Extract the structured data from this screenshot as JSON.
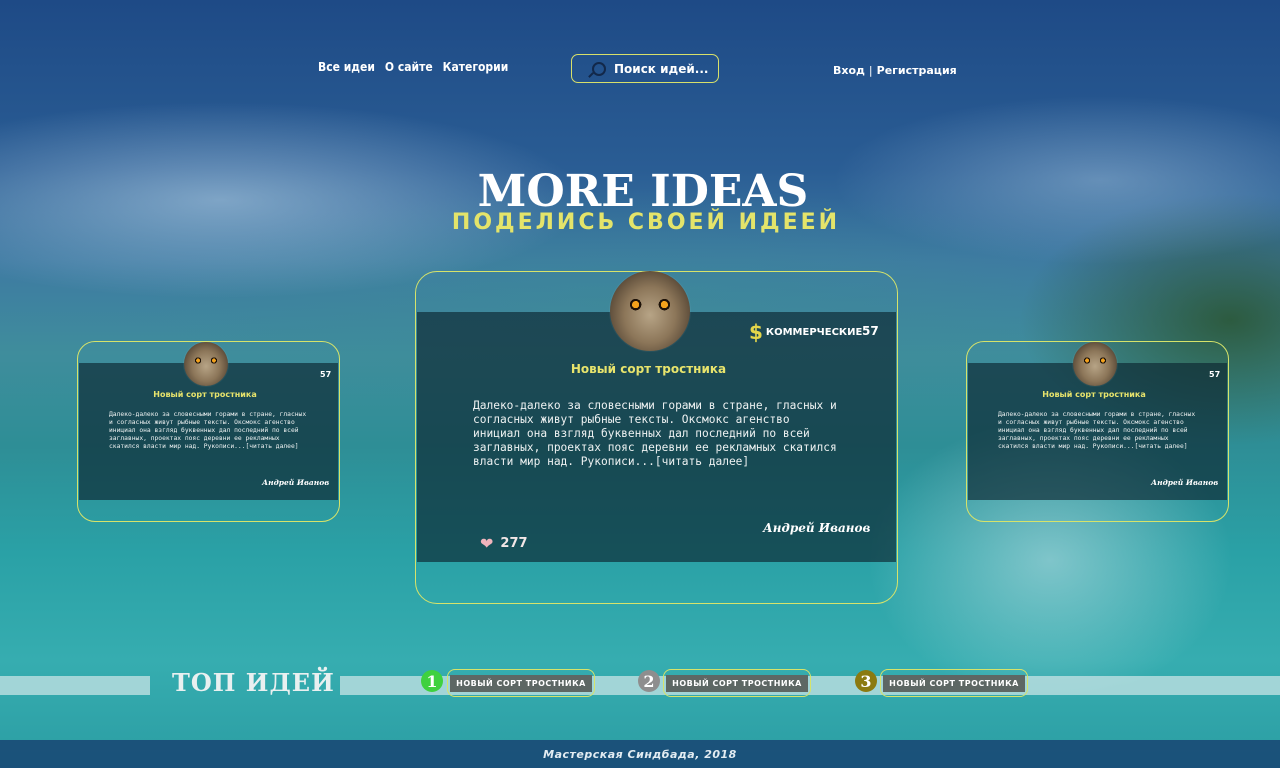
{
  "nav": {
    "items": [
      "Все идеи",
      "О сайте",
      "Категории"
    ]
  },
  "search": {
    "placeholder": "Поиск идей..."
  },
  "auth": {
    "login": "Вход",
    "separator": "|",
    "register": "Регистрация"
  },
  "hero": {
    "title": "MORE IDEAS",
    "subtitle": "ПОДЕЛИСЬ СВОЕЙ ИДЕЕЙ"
  },
  "cards": {
    "left": {
      "title": "Новый сорт тростника",
      "count": "57",
      "text": "Далеко-далеко за словесными горами в стране, гласных и согласных живут рыбные тексты. Оксмокс агенство инициал она взгляд буквенных дал последний по всей заглавных, проектах пояс деревни ее рекламных скатился власти мир над. Рукописи...[читать далее]",
      "author": "Андрей Иванов"
    },
    "center": {
      "title": "Новый сорт тростника",
      "category": "КОММЕРЧЕСКИЕ",
      "category_icon": "dollar-icon",
      "count": "57",
      "text": "Далеко-далеко за словесными горами в стране, гласных и согласных живут рыбные тексты. Оксмокс агенство инициал она взгляд буквенных дал последний по всей заглавных, проектах пояс деревни ее рекламных скатился власти мир над. Рукописи...[читать далее]",
      "author": "Андрей Иванов",
      "likes": "277"
    },
    "right": {
      "title": "Новый сорт тростника",
      "count": "57",
      "text": "Далеко-далеко за словесными горами в стране, гласных и согласных живут рыбные тексты. Оксмокс агенство инициал она взгляд буквенных дал последний по всей заглавных, проектах пояс деревни ее рекламных скатился власти мир над. Рукописи...[читать далее]",
      "author": "Андрей Иванов"
    }
  },
  "top": {
    "title": "ТОП ИДЕЙ",
    "items": [
      {
        "rank": "1",
        "label": "НОВЫЙ СОРТ ТРОСТНИКА",
        "color": "#3fd13f"
      },
      {
        "rank": "2",
        "label": "НОВЫЙ СОРТ ТРОСТНИКА",
        "color": "#8e8e8e"
      },
      {
        "rank": "3",
        "label": "НОВЫЙ СОРТ ТРОСТНИКА",
        "color": "#8b7a10"
      }
    ]
  },
  "footer": {
    "text": "Мастерская Синдбада, 2018"
  }
}
